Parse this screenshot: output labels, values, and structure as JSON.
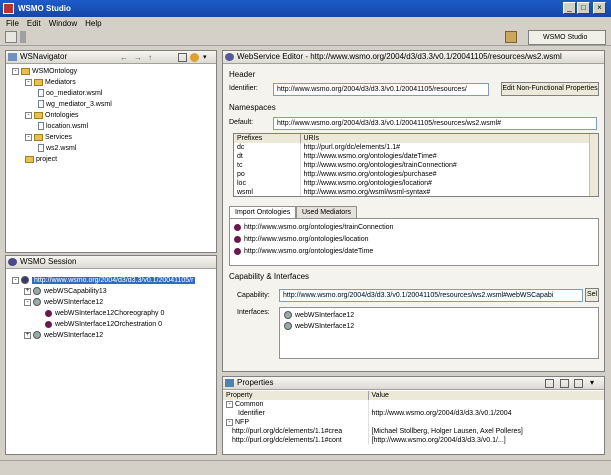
{
  "window": {
    "title": "WSMO Studio",
    "min": "_",
    "max": "□",
    "close": "×"
  },
  "menu": [
    "File",
    "Edit",
    "Window",
    "Help"
  ],
  "toolbar": {
    "perspective": "WSMO Studio"
  },
  "navigator": {
    "title": "WSNavigator",
    "tree": [
      {
        "depth": 0,
        "kind": "folder",
        "toggle": "-",
        "label": "WSMOntology"
      },
      {
        "depth": 1,
        "kind": "folder",
        "toggle": "-",
        "label": "Mediators"
      },
      {
        "depth": 2,
        "kind": "file",
        "toggle": "",
        "label": "oo_mediator.wsml"
      },
      {
        "depth": 2,
        "kind": "file",
        "toggle": "",
        "label": "wg_mediator_3.wsml"
      },
      {
        "depth": 1,
        "kind": "folder",
        "toggle": "-",
        "label": "Ontologies"
      },
      {
        "depth": 2,
        "kind": "file",
        "toggle": "",
        "label": "location.wsml"
      },
      {
        "depth": 1,
        "kind": "folder",
        "toggle": "-",
        "label": "Services"
      },
      {
        "depth": 2,
        "kind": "file",
        "toggle": "",
        "label": "ws2.wsml"
      },
      {
        "depth": 1,
        "kind": "folder",
        "toggle": "",
        "label": "project"
      }
    ]
  },
  "sessions": {
    "title": "WSMO Session",
    "tree": [
      {
        "depth": 0,
        "kind": "root",
        "toggle": "-",
        "label": "http://www.wsmo.org/2004/d3/d3.3/v0.1/20041105/r",
        "selected": true
      },
      {
        "depth": 1,
        "kind": "cap",
        "toggle": "+",
        "label": "webWSCapability13"
      },
      {
        "depth": 1,
        "kind": "iface",
        "toggle": "-",
        "label": "webWSInterface12"
      },
      {
        "depth": 2,
        "kind": "dot",
        "toggle": "",
        "label": "webWSInterface12Choreography 0"
      },
      {
        "depth": 2,
        "kind": "dot",
        "toggle": "",
        "label": "webWSInterface12Orchestration 0"
      },
      {
        "depth": 1,
        "kind": "iface",
        "toggle": "+",
        "label": "webWSInterface12"
      }
    ]
  },
  "editor": {
    "tab": "WebService Editor - http://www.wsmo.org/2004/d3/d3.3/v0.1/20041105/resources/ws2.wsml",
    "header_label": "Header",
    "identifier_label": "Identifier:",
    "identifier_value": "http://www.wsmo.org/2004/d3/d3.3/v0.1/20041105/resources/",
    "nfp_button": "Edit Non-Functional Properties",
    "namespaces_label": "Namespaces",
    "default_label": "Default:",
    "default_value": "http://www.wsmo.org/2004/d3/d3.3/v0.1/20041105/resources/ws2.wsml#",
    "ns_headers": [
      "Prefixes",
      "URIs"
    ],
    "ns_rows": [
      [
        "dc",
        "http://purl.org/dc/elements/1.1#"
      ],
      [
        "dt",
        "http://www.wsmo.org/ontologies/dateTime#"
      ],
      [
        "tc",
        "http://www.wsmo.org/ontologies/trainConnection#"
      ],
      [
        "po",
        "http://www.wsmo.org/ontologies/purchase#"
      ],
      [
        "loc",
        "http://www.wsmo.org/ontologies/location#"
      ],
      [
        "wsml",
        "http://www.wsmo.org/wsml/wsml-syntax#"
      ]
    ],
    "tabs": [
      "Import Ontologies",
      "Used Mediators"
    ],
    "imports": [
      "http://www.wsmo.org/ontologies/trainConnection",
      "http://www.wsmo.org/ontologies/location",
      "http://www.wsmo.org/ontologies/dateTime"
    ],
    "capif_label": "Capability & Interfaces",
    "capability_label": "Capability:",
    "capability_value": "http://www.wsmo.org/2004/d3/d3.3/v0.1/20041105/resources/ws2.wsml#webWSCapabi",
    "capability_button": "Sel",
    "interfaces_label": "Interfaces:",
    "interfaces": [
      "webWSInterface12",
      "webWSInterface12"
    ]
  },
  "properties": {
    "title": "Properties",
    "headers": [
      "Property",
      "Value"
    ],
    "rows": [
      {
        "toggle": "-",
        "prop": "Common",
        "value": "",
        "indent": 0
      },
      {
        "toggle": "",
        "prop": "Identifier",
        "value": "http://www.wsmo.org/2004/d3/d3.3/v0.1/2004",
        "indent": 2
      },
      {
        "toggle": "-",
        "prop": "NFP",
        "value": "",
        "indent": 0
      },
      {
        "toggle": "",
        "prop": "http://purl.org/dc/elements/1.1#crea",
        "value": "[Michael Stollberg, Holger Lausen, Axel Polleres]",
        "indent": 1
      },
      {
        "toggle": "",
        "prop": "http://purl.org/dc/elements/1.1#cont",
        "value": "[http://www.wsmo.org/2004/d3/d3.3/v0.1/...]",
        "indent": 1
      }
    ]
  }
}
